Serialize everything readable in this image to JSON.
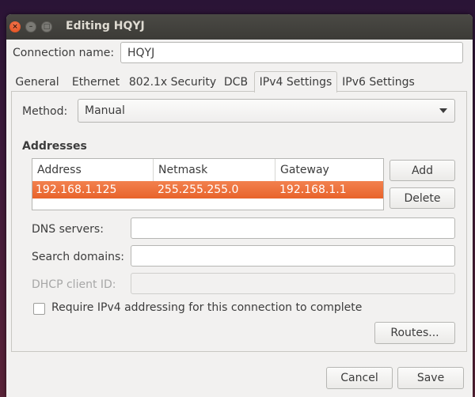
{
  "window": {
    "title": "Editing HQYJ",
    "close_glyph": "×",
    "min_glyph": "–",
    "max_glyph": "□"
  },
  "connection": {
    "name_label": "Connection name:",
    "name_value": "HQYJ"
  },
  "tabs": [
    {
      "label": "General"
    },
    {
      "label": "Ethernet"
    },
    {
      "label": "802.1x Security"
    },
    {
      "label": "DCB"
    },
    {
      "label": "IPv4 Settings",
      "active": true
    },
    {
      "label": "IPv6 Settings"
    }
  ],
  "ipv4": {
    "method_label": "Method:",
    "method_value": "Manual",
    "addresses_heading": "Addresses",
    "columns": [
      "Address",
      "Netmask",
      "Gateway"
    ],
    "rows": [
      {
        "address": "192.168.1.125",
        "netmask": "255.255.255.0",
        "gateway": "192.168.1.1",
        "selected": true
      }
    ],
    "add_label": "Add",
    "delete_label": "Delete",
    "dns_label": "DNS servers:",
    "dns_value": "",
    "search_label": "Search domains:",
    "search_value": "",
    "dhcp_label": "DHCP client ID:",
    "dhcp_value": "",
    "require_label": "Require IPv4 addressing for this connection to complete",
    "require_checked": false,
    "routes_label": "Routes..."
  },
  "footer": {
    "cancel_label": "Cancel",
    "save_label": "Save"
  },
  "colors": {
    "selection": "#e8632a",
    "titlebar": "#3c3b37",
    "window_bg": "#f2f1f0"
  }
}
